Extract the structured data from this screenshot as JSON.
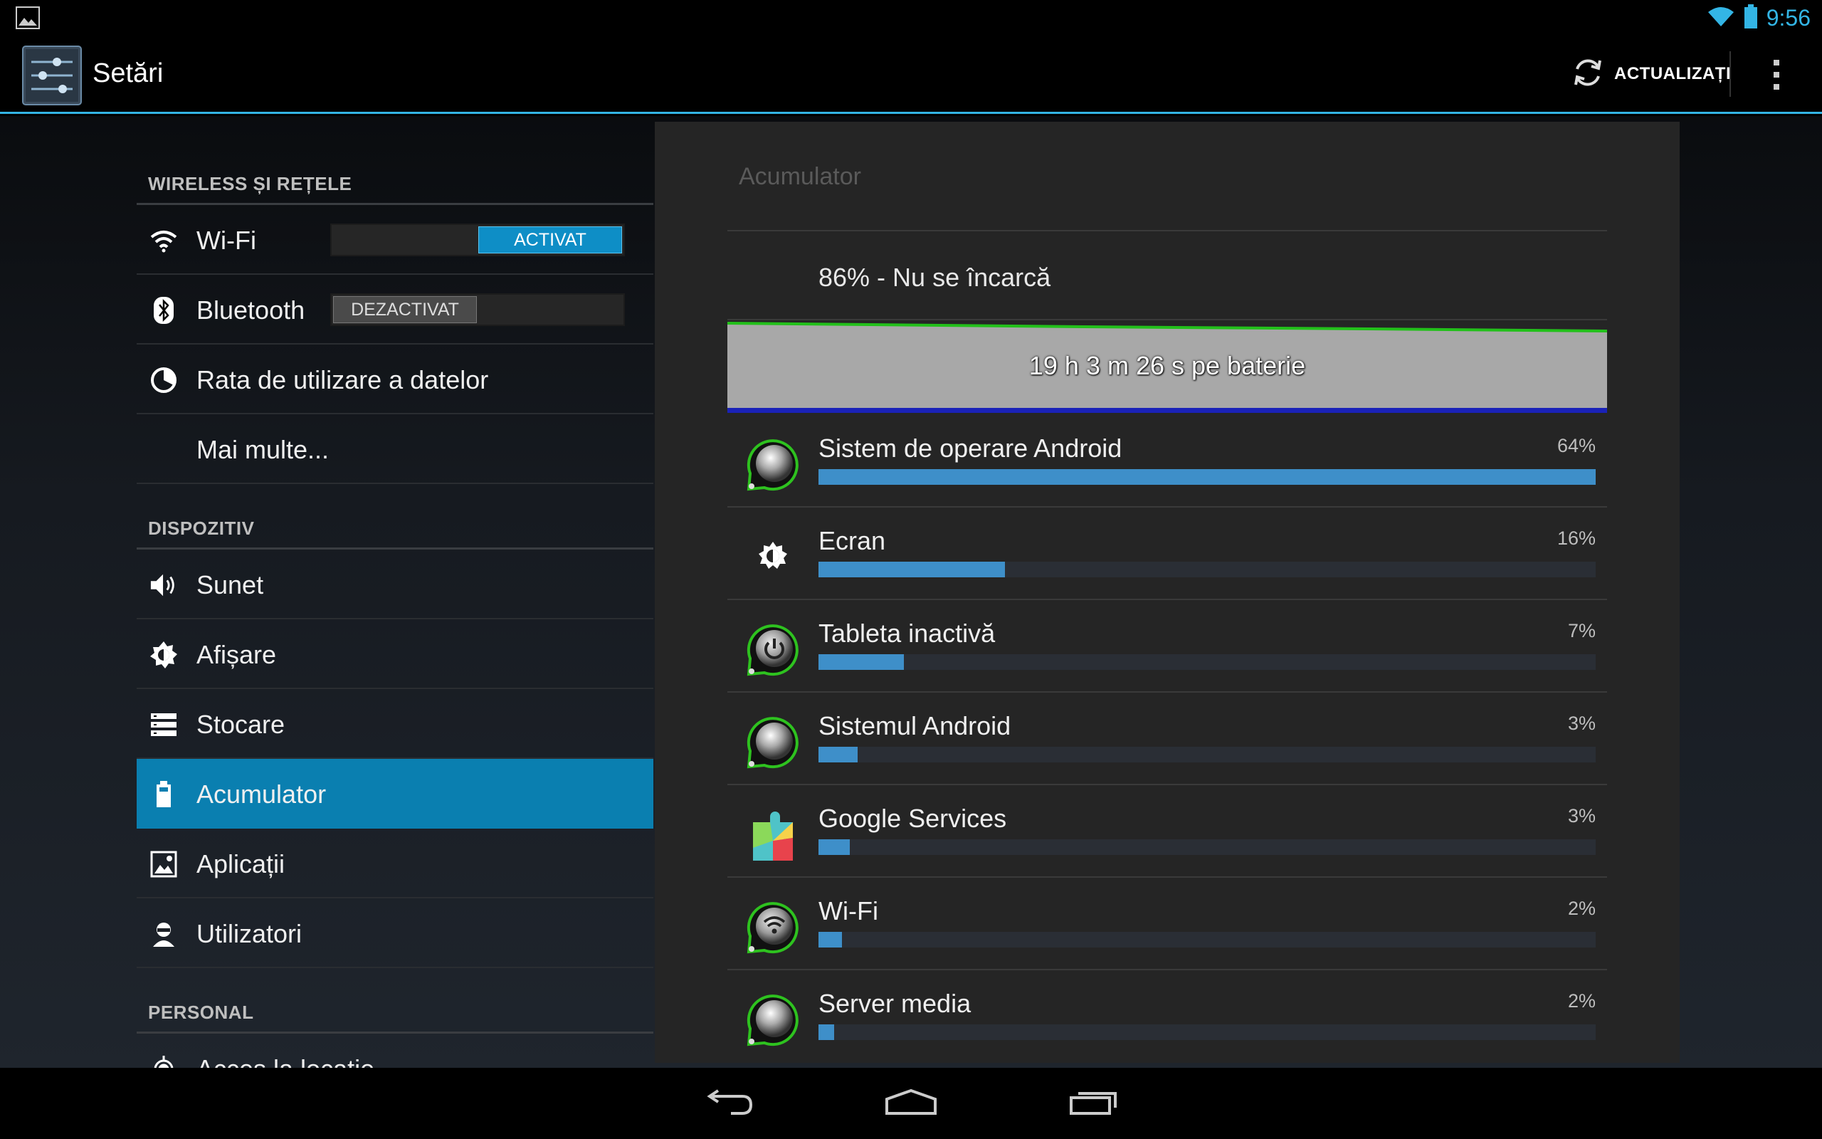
{
  "status_bar": {
    "time": "9:56"
  },
  "action_bar": {
    "title": "Setări",
    "refresh_label": "ACTUALIZAȚI"
  },
  "nav": {
    "sections": [
      {
        "header": "WIRELESS ȘI REȚELE"
      },
      {
        "header": "DISPOZITIV"
      },
      {
        "header": "PERSONAL"
      }
    ],
    "items": {
      "wifi": {
        "label": "Wi-Fi",
        "toggle": "ACTIVAT"
      },
      "bluetooth": {
        "label": "Bluetooth",
        "toggle": "DEZACTIVAT"
      },
      "data_usage": {
        "label": "Rata de utilizare a datelor"
      },
      "more": {
        "label": "Mai multe..."
      },
      "sound": {
        "label": "Sunet"
      },
      "display": {
        "label": "Afișare"
      },
      "storage": {
        "label": "Stocare"
      },
      "battery": {
        "label": "Acumulator"
      },
      "apps": {
        "label": "Aplicații"
      },
      "users": {
        "label": "Utilizatori"
      },
      "location": {
        "label": "Acces la locație"
      }
    }
  },
  "panel": {
    "title": "Acumulator",
    "status": "86% - Nu se încarcă",
    "graph_text": "19 h 3 m 26 s pe baterie",
    "usage": [
      {
        "name": "Sistem de operare Android",
        "percent_label": "64%",
        "fraction": 1.0,
        "icon": "android-os-icon"
      },
      {
        "name": "Ecran",
        "percent_label": "16%",
        "fraction": 0.24,
        "icon": "brightness-icon"
      },
      {
        "name": "Tableta inactivă",
        "percent_label": "7%",
        "fraction": 0.11,
        "icon": "power-icon"
      },
      {
        "name": "Sistemul Android",
        "percent_label": "3%",
        "fraction": 0.05,
        "icon": "android-system-icon"
      },
      {
        "name": "Google Services",
        "percent_label": "3%",
        "fraction": 0.04,
        "icon": "google-services-icon"
      },
      {
        "name": "Wi-Fi",
        "percent_label": "2%",
        "fraction": 0.03,
        "icon": "wifi-icon"
      },
      {
        "name": "Server media",
        "percent_label": "2%",
        "fraction": 0.02,
        "icon": "media-server-icon"
      }
    ]
  }
}
